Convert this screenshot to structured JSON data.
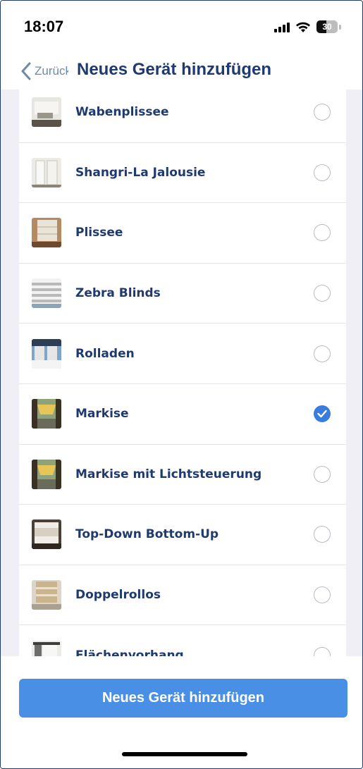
{
  "status_bar": {
    "time": "18:07",
    "battery": "30",
    "icons": [
      "signal-icon",
      "wifi-icon",
      "battery-icon"
    ]
  },
  "nav": {
    "back_label": "Zurück",
    "title": "Neues Gerät hinzufügen",
    "back_icon": "chevron-left-icon"
  },
  "devices": [
    {
      "label": "Wabenplissee",
      "selected": false
    },
    {
      "label": "Shangri-La Jalousie",
      "selected": false
    },
    {
      "label": "Plissee",
      "selected": false
    },
    {
      "label": "Zebra Blinds",
      "selected": false
    },
    {
      "label": "Rolladen",
      "selected": false
    },
    {
      "label": "Markise",
      "selected": true
    },
    {
      "label": "Markise mit Lichtsteuerung",
      "selected": false
    },
    {
      "label": "Top-Down Bottom-Up",
      "selected": false
    },
    {
      "label": "Doppelrollos",
      "selected": false
    },
    {
      "label": "Flächenvorhang",
      "selected": false
    }
  ],
  "footer": {
    "button_label": "Neues Gerät hinzufügen"
  },
  "colors": {
    "accent": "#4a8fe6",
    "check": "#3a7be0",
    "title": "#1f3a6e",
    "list_background": "#efeff5"
  }
}
